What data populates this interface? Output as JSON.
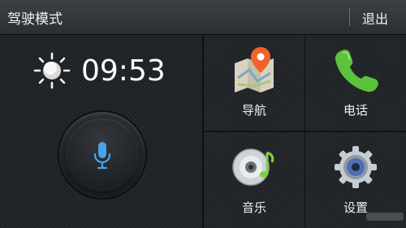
{
  "header": {
    "title": "驾驶模式",
    "exit_label": "退出"
  },
  "status": {
    "time": "09:53",
    "weather_icon": "sunny-icon"
  },
  "voice": {
    "icon": "microphone-icon"
  },
  "apps": [
    {
      "label": "导航",
      "icon": "map-pin-icon"
    },
    {
      "label": "电话",
      "icon": "phone-icon"
    },
    {
      "label": "音乐",
      "icon": "music-disc-icon"
    },
    {
      "label": "设置",
      "icon": "gear-icon"
    }
  ],
  "colors": {
    "accent_blue": "#4aa3e8",
    "background": "#1f2225"
  }
}
